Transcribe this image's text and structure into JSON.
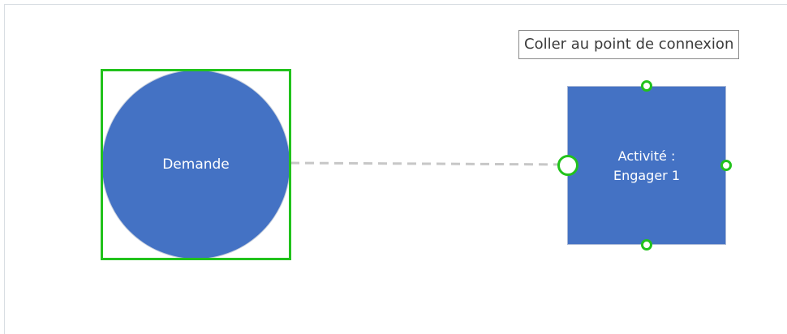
{
  "tooltip": {
    "text": "Coller au point de connexion"
  },
  "shapes": {
    "circle": {
      "label": "Demande",
      "fill": "#4472c4"
    },
    "rectangle": {
      "label_line1": "Activité :",
      "label_line2": "Engager 1",
      "fill": "#4472c4"
    }
  },
  "colors": {
    "selection": "#22c21c",
    "connector": "#c7c7c7",
    "text": "#ffffff"
  }
}
